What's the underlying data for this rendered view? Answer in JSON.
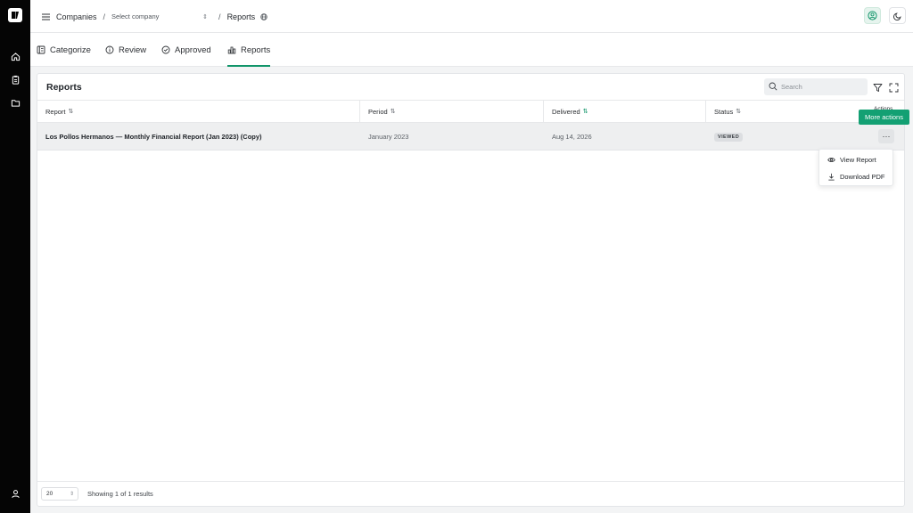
{
  "app": {
    "logo_alt": "app-logo"
  },
  "breadcrumbs": {
    "first": "Companies",
    "separator": "/",
    "company_placeholder": "Select company",
    "current": "Reports"
  },
  "tabs": [
    {
      "label": "Categorize",
      "icon": "categorize-icon"
    },
    {
      "label": "Review",
      "icon": "info-icon"
    },
    {
      "label": "Approved",
      "icon": "check-circle-icon"
    },
    {
      "label": "Reports",
      "icon": "bar-chart-icon",
      "active": true
    }
  ],
  "card": {
    "title": "Reports",
    "search_placeholder": "Search"
  },
  "table": {
    "columns": [
      "Report",
      "Period",
      "Delivered",
      "Status",
      "Actions"
    ],
    "rows": [
      {
        "report": "Los Pollos Hermanos — Monthly Financial Report (Jan 2023) (Copy)",
        "period": "January 2023",
        "delivered": "Aug 14, 2026",
        "status": "VIEWED"
      }
    ]
  },
  "more_actions": {
    "tooltip": "More actions",
    "button_glyph": "···",
    "items": [
      {
        "label": "View Report",
        "icon": "eye-icon"
      },
      {
        "label": "Download PDF",
        "icon": "download-icon"
      }
    ]
  },
  "footer": {
    "page_size": "20",
    "results_text": "Showing 1 of 1 results"
  },
  "colors": {
    "accent": "#12956a",
    "tooltip_bg": "#13a073",
    "rail_bg": "#050505"
  }
}
